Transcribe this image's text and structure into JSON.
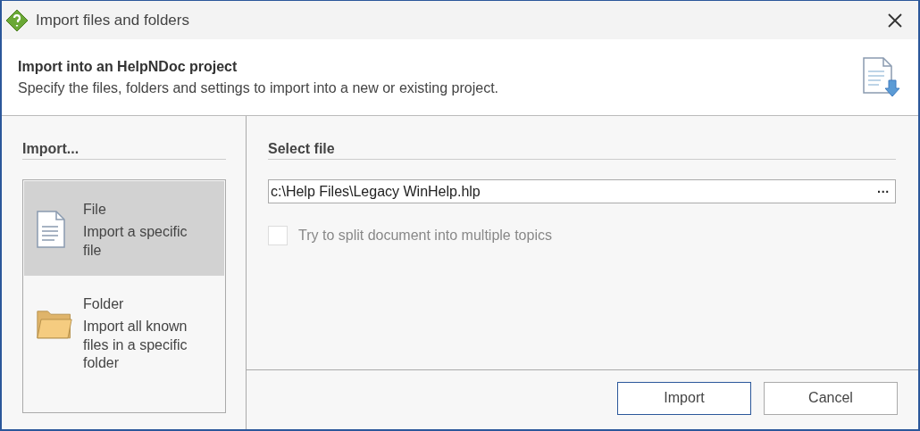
{
  "window": {
    "title": "Import files and folders"
  },
  "header": {
    "title": "Import into an HelpNDoc project",
    "subtitle": "Specify the files, folders and settings to import into a new or existing project."
  },
  "import_panel": {
    "heading": "Import...",
    "options": [
      {
        "kind": "file",
        "title": "File",
        "description": "Import a specific file",
        "selected": true
      },
      {
        "kind": "folder",
        "title": "Folder",
        "description": "Import all known files in a specific folder",
        "selected": false
      }
    ]
  },
  "select_file": {
    "heading": "Select file",
    "path": "c:\\Help Files\\Legacy WinHelp.hlp",
    "browse": "···",
    "split_option": {
      "label": "Try to split document into multiple topics",
      "checked": false,
      "disabled": true
    }
  },
  "buttons": [
    {
      "label": "Import",
      "default": true
    },
    {
      "label": "Cancel",
      "default": false
    }
  ]
}
